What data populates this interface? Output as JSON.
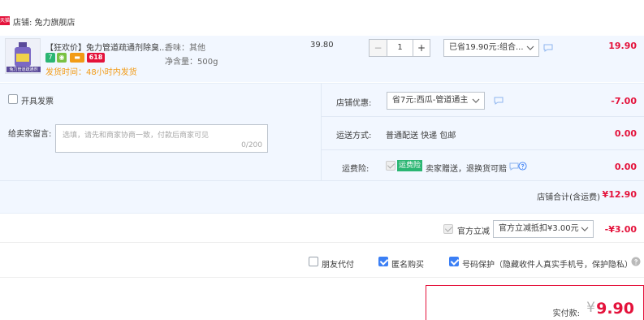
{
  "store": {
    "badge": "天猫",
    "label": "店铺: 兔力旗舰店"
  },
  "item": {
    "title": "【狂欢价】兔力管道疏通剂除臭...",
    "attr_flavor": "香味：其他",
    "attr_weight": "净含量：500g",
    "ship_time": "发货时间：48小时内发货",
    "badge_618": "618",
    "image_caption": "兔力管道疏通剂",
    "unit_price": "39.80",
    "quantity": "1",
    "minus": "−",
    "plus": "+",
    "discount_select": "已省19.90元:组合...",
    "subtotal": "19.90"
  },
  "invoice": {
    "label": "开具发票"
  },
  "message": {
    "label": "给卖家留言:",
    "placeholder": "选填，请先和商家协商一致，付款后商家可见",
    "counter": "0/200"
  },
  "shop_discount": {
    "label": "店铺优惠:",
    "select": "省7元:西瓜-管道通主",
    "amount": "-7.00"
  },
  "delivery": {
    "label": "运送方式:",
    "value": "普通配送 快递 包邮",
    "amount": "0.00"
  },
  "insurance": {
    "label": "运费险:",
    "tag": "运费险",
    "desc": "卖家赠送，退换货可赔",
    "amount": "0.00"
  },
  "shop_total": {
    "label": "店铺合计(含运费)",
    "amount": "¥12.90"
  },
  "official": {
    "label": "官方立减",
    "select": "官方立减抵扣¥3.00元",
    "amount": "-¥3.00"
  },
  "options": {
    "friend_pay": "朋友代付",
    "anonymous": "匿名购买",
    "privacy": "号码保护（隐藏收件人真实手机号，保护隐私）"
  },
  "payment": {
    "label": "实付款:",
    "currency": "¥",
    "amount": "9.90"
  },
  "colors": {
    "accent": "#e4123b",
    "blue": "#3b7ff5",
    "panel": "#f2f7ff"
  }
}
